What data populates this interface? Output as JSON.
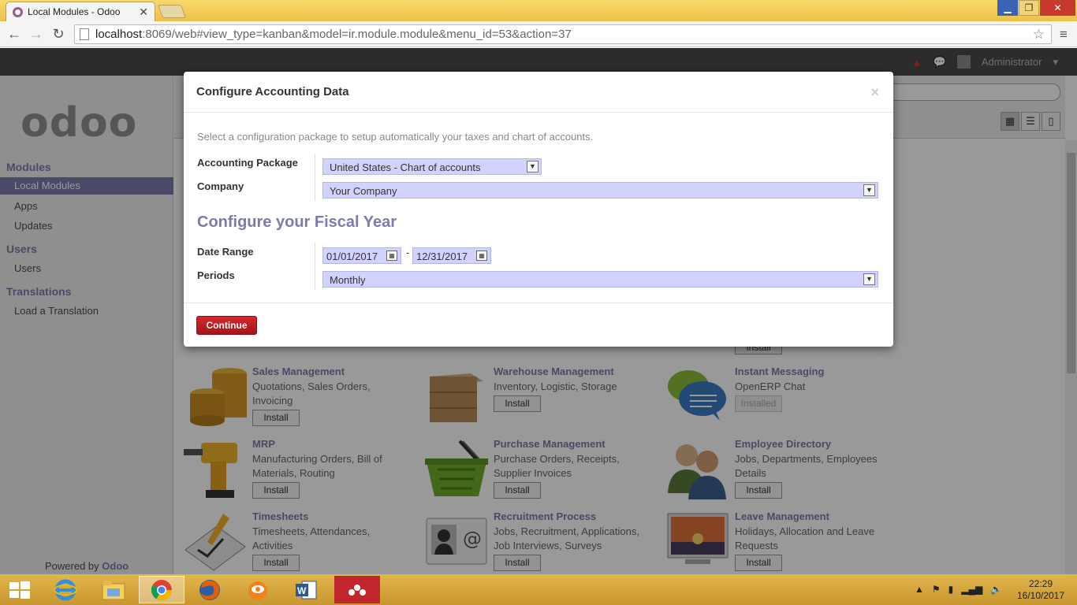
{
  "browser": {
    "tab_title": "Local Modules - Odoo",
    "url_host": "localhost",
    "url_path": ":8069/web#view_type=kanban&model=ir.module.module&menu_id=53&action=37"
  },
  "topbar": {
    "user": "Administrator"
  },
  "sidebar": {
    "logo": "odoo",
    "sections": [
      {
        "title": "Modules",
        "items": [
          "Local Modules",
          "Apps",
          "Updates"
        ]
      },
      {
        "title": "Users",
        "items": [
          "Users"
        ]
      },
      {
        "title": "Translations",
        "items": [
          "Load a Translation"
        ]
      }
    ],
    "powered_prefix": "Powered by",
    "powered_brand": "Odoo"
  },
  "modules": [
    {
      "name": "Sales Management",
      "desc": "Quotations, Sales Orders, Invoicing",
      "button": "Install"
    },
    {
      "name": "Warehouse Management",
      "desc": "Inventory, Logistic, Storage",
      "button": "Install"
    },
    {
      "name": "Instant Messaging",
      "desc": "OpenERP Chat",
      "button": "Installed"
    },
    {
      "name": "MRP",
      "desc": "Manufacturing Orders, Bill of Materials, Routing",
      "button": "Install"
    },
    {
      "name": "Purchase Management",
      "desc": "Purchase Orders, Receipts, Supplier Invoices",
      "button": "Install"
    },
    {
      "name": "Employee Directory",
      "desc": "Jobs, Departments, Employees Details",
      "button": "Install"
    },
    {
      "name": "Timesheets",
      "desc": "Timesheets, Attendances, Activities",
      "button": "Install"
    },
    {
      "name": "Recruitment Process",
      "desc": "Jobs, Recruitment, Applications, Job Interviews, Surveys",
      "button": "Install"
    },
    {
      "name": "Leave Management",
      "desc": "Holidays, Allocation and Leave Requests",
      "button": "Install"
    }
  ],
  "partial_install_label": "Install",
  "modal": {
    "title": "Configure Accounting Data",
    "close": "×",
    "intro": "Select a configuration package to setup automatically your taxes and chart of accounts.",
    "accounting_package_label": "Accounting Package",
    "accounting_package_value": "United States - Chart of accounts",
    "company_label": "Company",
    "company_value": "Your Company",
    "fiscal_title": "Configure your Fiscal Year",
    "date_range_label": "Date Range",
    "date_from": "01/01/2017",
    "date_separator": "-",
    "date_to": "12/31/2017",
    "periods_label": "Periods",
    "periods_value": "Monthly",
    "continue": "Continue"
  },
  "taskbar": {
    "time": "22:29",
    "date": "16/10/2017"
  },
  "colors": {
    "accent": "#7c7bad",
    "brand": "#a24689",
    "primary_button": "#b5161d"
  }
}
